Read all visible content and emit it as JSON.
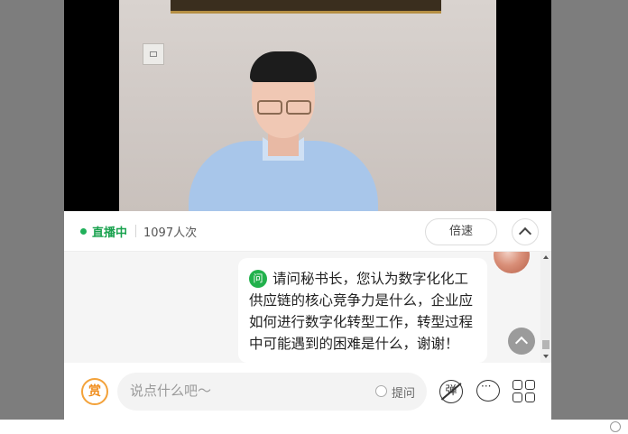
{
  "status": {
    "live_label": "直播中",
    "viewer_count": "1097人次",
    "speed_button": "倍速"
  },
  "chat": {
    "question_badge": "问",
    "question_text": "请问秘书长，您认为数字化化工供应链的核心竞争力是什么，企业应如何进行数字化转型工作，转型过程中可能遇到的困难是什么，谢谢！"
  },
  "composer": {
    "reward_label": "赏",
    "placeholder": "说点什么吧～",
    "ask_label": "提问",
    "danmaku_label": "弹"
  },
  "icons": [
    "collapse-chevron-up-icon",
    "scroll-to-top-icon",
    "danmaku-icon",
    "chat-bubble-icon",
    "grid-menu-icon"
  ],
  "colors": {
    "live_green": "#1aa24f",
    "reward_orange": "#f08c1a"
  }
}
